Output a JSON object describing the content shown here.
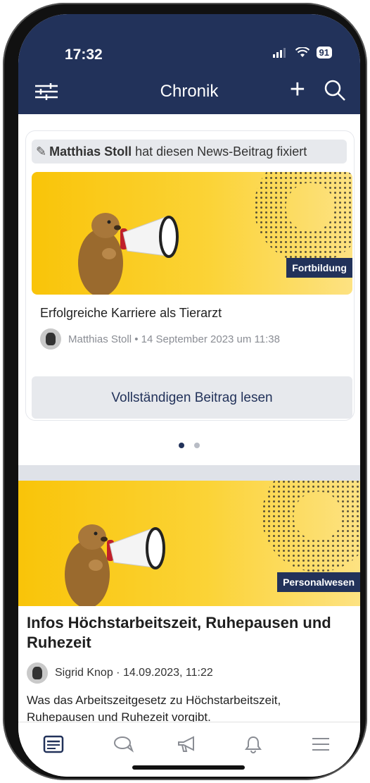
{
  "status": {
    "time": "17:32",
    "battery": "91"
  },
  "nav": {
    "title": "Chronik",
    "plus": "+"
  },
  "pinned_card": {
    "banner_name": "Matthias Stoll",
    "banner_text": " hat diesen News-Beitrag fixiert",
    "tag": "Fortbildung",
    "title": "Erfolgreiche Karriere als Tierarzt",
    "meta": "Matthias Stoll • 14 September 2023 um 11:38",
    "button": "Vollständigen Beitrag lesen"
  },
  "pager": {
    "count": 2,
    "active": 0
  },
  "post": {
    "tag": "Personalwesen",
    "title": "Infos Höchstarbeitszeit, Ruhepausen und Ruhezeit",
    "meta": "Sigrid Knop · 14.09.2023, 11:22",
    "excerpt": "Was das Arbeitszeitgesetz zu Höchstarbeitszeit, Ruhepausen und Ruhezeit vorgibt."
  },
  "tabbar": {
    "items": [
      "news-icon",
      "chat-icon",
      "megaphone-icon",
      "bell-icon",
      "menu-icon"
    ],
    "active": 0
  },
  "colors": {
    "navy": "#22325a",
    "yellow": "#f9c409",
    "grey": "#e7e9ed"
  }
}
